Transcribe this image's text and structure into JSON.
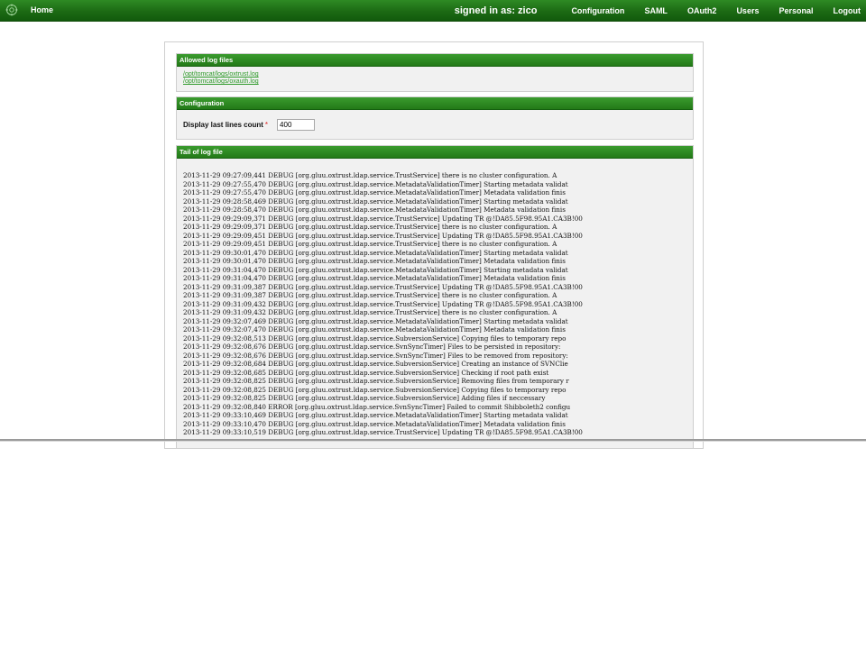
{
  "topbar": {
    "home": "Home",
    "signed_in": "signed in as: zico",
    "links": [
      "Configuration",
      "SAML",
      "OAuth2",
      "Users",
      "Personal",
      "Logout"
    ]
  },
  "allowed_files": {
    "header": "Allowed log files",
    "files": [
      "/opt/tomcat/logs/oxtrust.log",
      "/opt/tomcat/logs/oxauth.log"
    ]
  },
  "configuration": {
    "header": "Configuration",
    "label": "Display last lines count",
    "required_mark": "*",
    "value": "400"
  },
  "tail": {
    "header": "Tail of log file",
    "lines": [
      "2013-11-29 09:27:09,441 DEBUG [org.gluu.oxtrust.ldap.service.TrustService] there is no cluster configuration. A",
      "2013-11-29 09:27:55,470 DEBUG [org.gluu.oxtrust.ldap.service.MetadataValidationTimer] Starting metadata validat",
      "2013-11-29 09:27:55,470 DEBUG [org.gluu.oxtrust.ldap.service.MetadataValidationTimer] Metadata validation finis",
      "2013-11-29 09:28:58,469 DEBUG [org.gluu.oxtrust.ldap.service.MetadataValidationTimer] Starting metadata validat",
      "2013-11-29 09:28:58,470 DEBUG [org.gluu.oxtrust.ldap.service.MetadataValidationTimer] Metadata validation finis",
      "2013-11-29 09:29:09,371 DEBUG [org.gluu.oxtrust.ldap.service.TrustService] Updating TR @!DA85.5F98.95A1.CA3B!00",
      "2013-11-29 09:29:09,371 DEBUG [org.gluu.oxtrust.ldap.service.TrustService] there is no cluster configuration. A",
      "2013-11-29 09:29:09,451 DEBUG [org.gluu.oxtrust.ldap.service.TrustService] Updating TR @!DA85.5F98.95A1.CA3B!00",
      "2013-11-29 09:29:09,451 DEBUG [org.gluu.oxtrust.ldap.service.TrustService] there is no cluster configuration. A",
      "2013-11-29 09:30:01,470 DEBUG [org.gluu.oxtrust.ldap.service.MetadataValidationTimer] Starting metadata validat",
      "2013-11-29 09:30:01,470 DEBUG [org.gluu.oxtrust.ldap.service.MetadataValidationTimer] Metadata validation finis",
      "2013-11-29 09:31:04,470 DEBUG [org.gluu.oxtrust.ldap.service.MetadataValidationTimer] Starting metadata validat",
      "2013-11-29 09:31:04,470 DEBUG [org.gluu.oxtrust.ldap.service.MetadataValidationTimer] Metadata validation finis",
      "2013-11-29 09:31:09,387 DEBUG [org.gluu.oxtrust.ldap.service.TrustService] Updating TR @!DA85.5F98.95A1.CA3B!00",
      "2013-11-29 09:31:09,387 DEBUG [org.gluu.oxtrust.ldap.service.TrustService] there is no cluster configuration. A",
      "2013-11-29 09:31:09,432 DEBUG [org.gluu.oxtrust.ldap.service.TrustService] Updating TR @!DA85.5F98.95A1.CA3B!00",
      "2013-11-29 09:31:09,432 DEBUG [org.gluu.oxtrust.ldap.service.TrustService] there is no cluster configuration. A",
      "2013-11-29 09:32:07,469 DEBUG [org.gluu.oxtrust.ldap.service.MetadataValidationTimer] Starting metadata validat",
      "2013-11-29 09:32:07,470 DEBUG [org.gluu.oxtrust.ldap.service.MetadataValidationTimer] Metadata validation finis",
      "2013-11-29 09:32:08,513 DEBUG [org.gluu.oxtrust.ldap.service.SubversionService] Copying files to temporary repo",
      "2013-11-29 09:32:08,676 DEBUG [org.gluu.oxtrust.ldap.service.SvnSyncTimer] Files to be persisted in repository:",
      "2013-11-29 09:32:08,676 DEBUG [org.gluu.oxtrust.ldap.service.SvnSyncTimer] Files to be removed from repository:",
      "2013-11-29 09:32:08,684 DEBUG [org.gluu.oxtrust.ldap.service.SubversionService] Creating an instance of SVNClie",
      "2013-11-29 09:32:08,685 DEBUG [org.gluu.oxtrust.ldap.service.SubversionService] Checking if root path exist",
      "2013-11-29 09:32:08,825 DEBUG [org.gluu.oxtrust.ldap.service.SubversionService] Removing files from temporary r",
      "2013-11-29 09:32:08,825 DEBUG [org.gluu.oxtrust.ldap.service.SubversionService] Copying files to temporary repo",
      "2013-11-29 09:32:08,825 DEBUG [org.gluu.oxtrust.ldap.service.SubversionService] Adding files if neccessary",
      "2013-11-29 09:32:08,840 ERROR [org.gluu.oxtrust.ldap.service.SvnSyncTimer] Failed to commit Shibboleth2 configu",
      "2013-11-29 09:33:10,469 DEBUG [org.gluu.oxtrust.ldap.service.MetadataValidationTimer] Starting metadata validat",
      "2013-11-29 09:33:10,470 DEBUG [org.gluu.oxtrust.ldap.service.MetadataValidationTimer] Metadata validation finis",
      "2013-11-29 09:33:10,519 DEBUG [org.gluu.oxtrust.ldap.service.TrustService] Updating TR @!DA85.5F98.95A1.CA3B!00"
    ]
  }
}
